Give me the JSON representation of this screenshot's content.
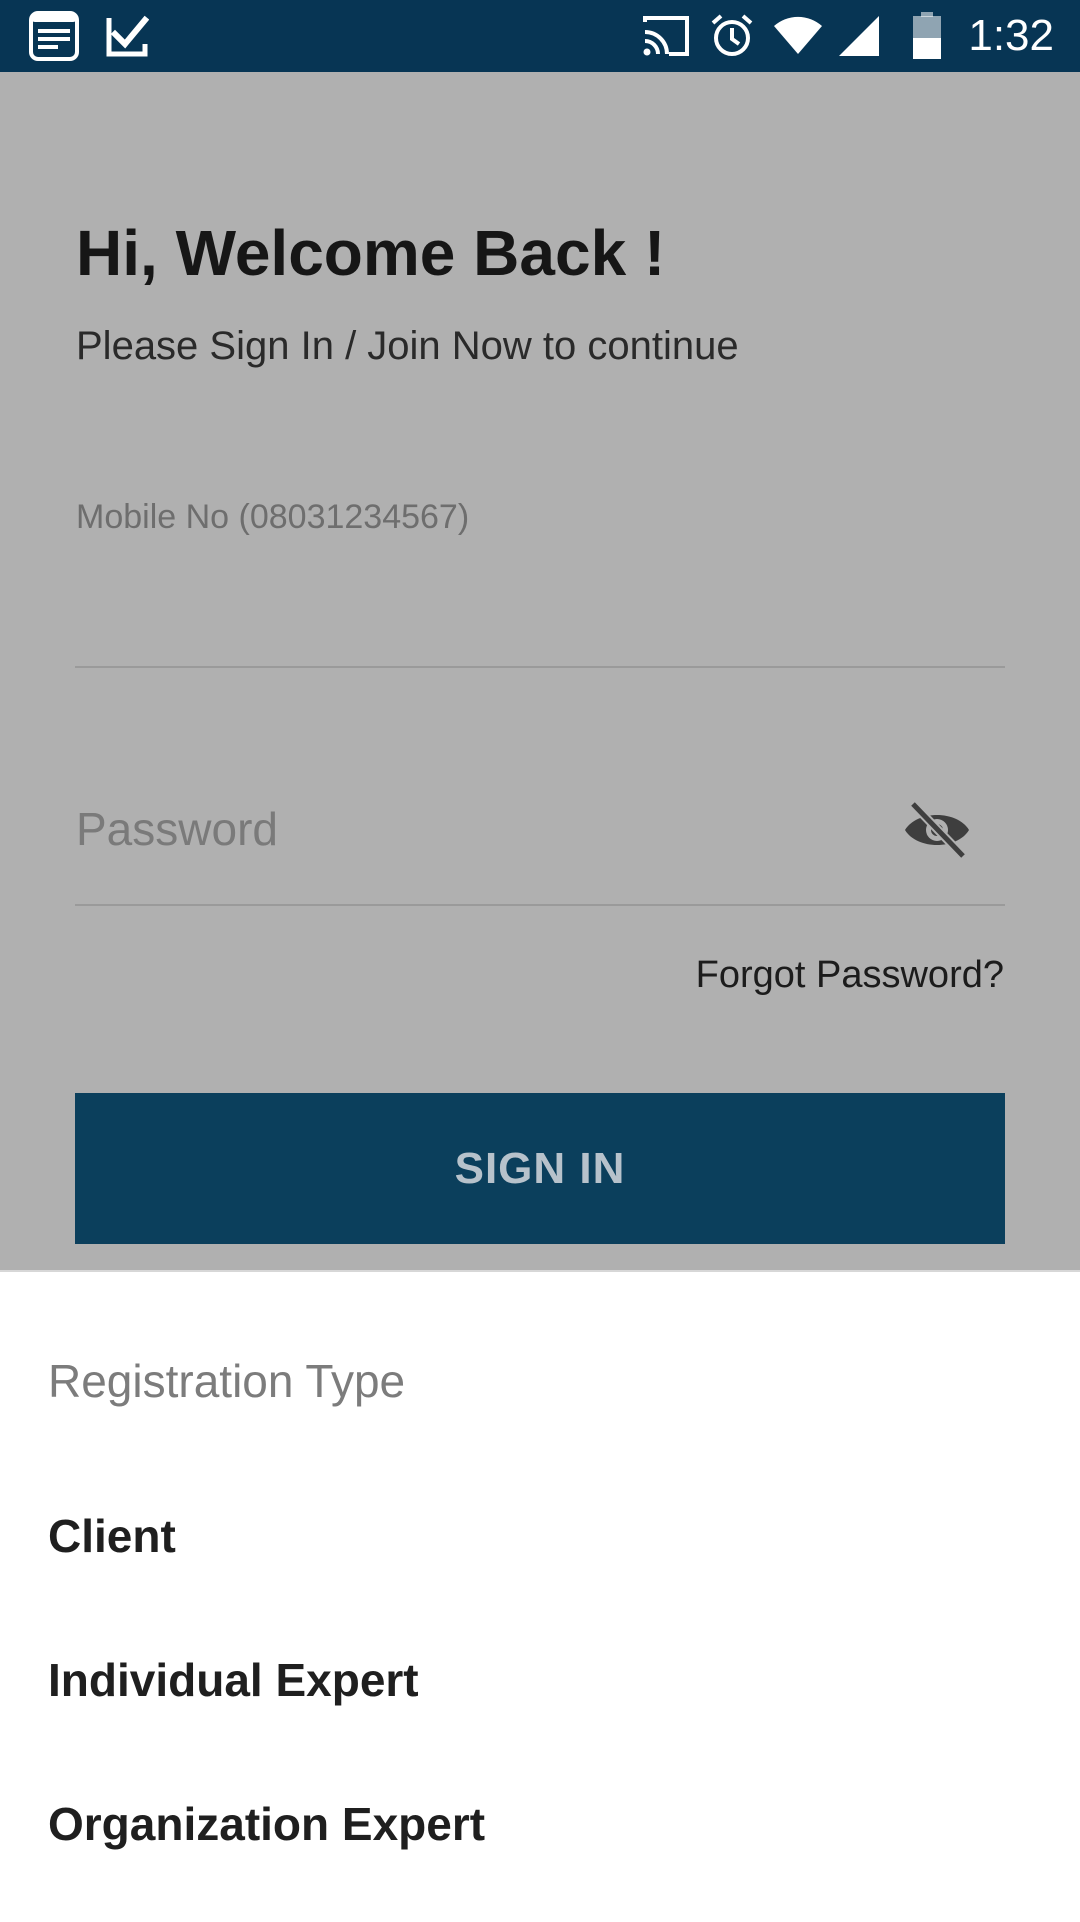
{
  "status_bar": {
    "time": "1:32",
    "left_icons": [
      "notes-icon",
      "task-check-icon"
    ],
    "right_icons": [
      "cast-icon",
      "alarm-icon",
      "wifi-icon",
      "signal-icon",
      "battery-icon"
    ],
    "background_color": "#073554"
  },
  "login": {
    "title": "Hi, Welcome Back !",
    "subtitle": "Please Sign In / Join Now to continue",
    "mobile_placeholder": "Mobile No (08031234567)",
    "password_placeholder": "Password",
    "forgot_password": "Forgot Password?",
    "sign_in_label": "SIGN IN",
    "button_color": "#0b3f5c"
  },
  "registration_sheet": {
    "title": "Registration Type",
    "options": [
      {
        "label": "Client"
      },
      {
        "label": "Individual Expert"
      },
      {
        "label": "Organization Expert"
      }
    ]
  }
}
